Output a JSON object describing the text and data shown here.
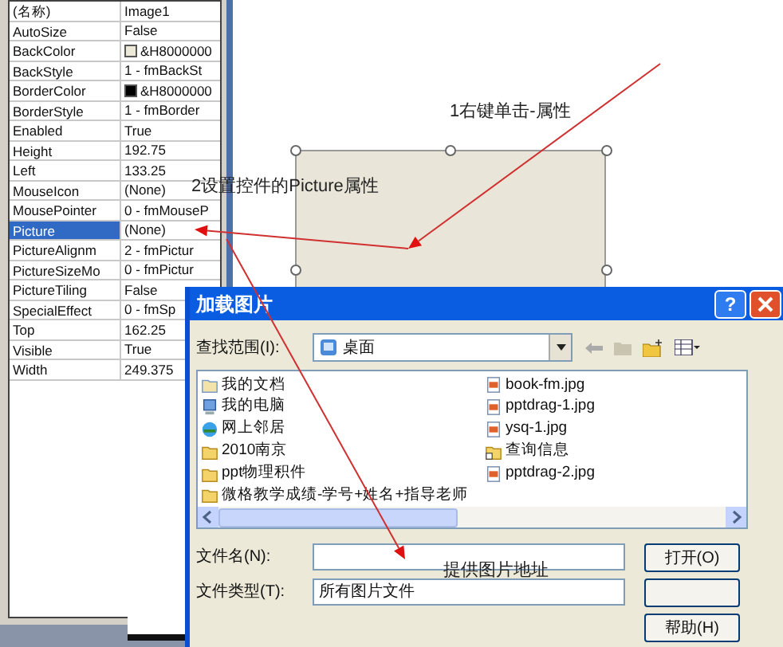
{
  "properties_panel": {
    "rows": [
      {
        "name": "(名称)",
        "value": "Image1",
        "selected": false
      },
      {
        "name": "AutoSize",
        "value": "False",
        "selected": false
      },
      {
        "name": "BackColor",
        "value": "&H8000000",
        "color": "#ece9d8",
        "selected": false
      },
      {
        "name": "BackStyle",
        "value": "1 - fmBackSt",
        "selected": false
      },
      {
        "name": "BorderColor",
        "value": "&H8000000",
        "color": "#000000",
        "selected": false
      },
      {
        "name": "BorderStyle",
        "value": "1 - fmBorder",
        "selected": false
      },
      {
        "name": "Enabled",
        "value": "True",
        "selected": false
      },
      {
        "name": "Height",
        "value": "192.75",
        "selected": false
      },
      {
        "name": "Left",
        "value": "133.25",
        "selected": false
      },
      {
        "name": "MouseIcon",
        "value": "(None)",
        "selected": false
      },
      {
        "name": "MousePointer",
        "value": "0 - fmMouseP",
        "selected": false
      },
      {
        "name": "Picture",
        "value": "(None)",
        "selected": true
      },
      {
        "name": "PictureAlignm",
        "value": "2 - fmPictur",
        "selected": false
      },
      {
        "name": "PictureSizeMo",
        "value": "0 - fmPictur",
        "selected": false
      },
      {
        "name": "PictureTiling",
        "value": "False",
        "selected": false
      },
      {
        "name": "SpecialEffect",
        "value": "0 - fmSp",
        "selected": false
      },
      {
        "name": "Top",
        "value": "162.25",
        "selected": false
      },
      {
        "name": "Visible",
        "value": "True",
        "selected": false
      },
      {
        "name": "Width",
        "value": "249.375",
        "selected": false
      }
    ]
  },
  "annotations": [
    "1右键单击-属性",
    "2设置控件的Picture属性",
    "提供图片地址"
  ],
  "dialog": {
    "title": "加载图片",
    "help_button": "?",
    "look_in_label": "查找范围(I):",
    "look_in_value": "桌面",
    "files": [
      {
        "name": "我的文档",
        "kind": "documents"
      },
      {
        "name": "我的电脑",
        "kind": "computer"
      },
      {
        "name": "网上邻居",
        "kind": "network"
      },
      {
        "name": "2010南京",
        "kind": "folder"
      },
      {
        "name": "ppt物理积件",
        "kind": "folder"
      },
      {
        "name": "微格教学成绩-学号+姓名+指导老师",
        "kind": "folder"
      },
      {
        "name": "book-fm.jpg",
        "kind": "image"
      },
      {
        "name": "pptdrag-1.jpg",
        "kind": "image"
      },
      {
        "name": "ysq-1.jpg",
        "kind": "image"
      },
      {
        "name": "查询信息",
        "kind": "shortcut"
      },
      {
        "name": "pptdrag-2.jpg",
        "kind": "image"
      }
    ],
    "file_name_label": "文件名(N):",
    "file_type_label": "文件类型(T):",
    "file_type_value": "所有图片文件",
    "open_button": "打开(O)",
    "help_text_button": "帮助(H)"
  }
}
